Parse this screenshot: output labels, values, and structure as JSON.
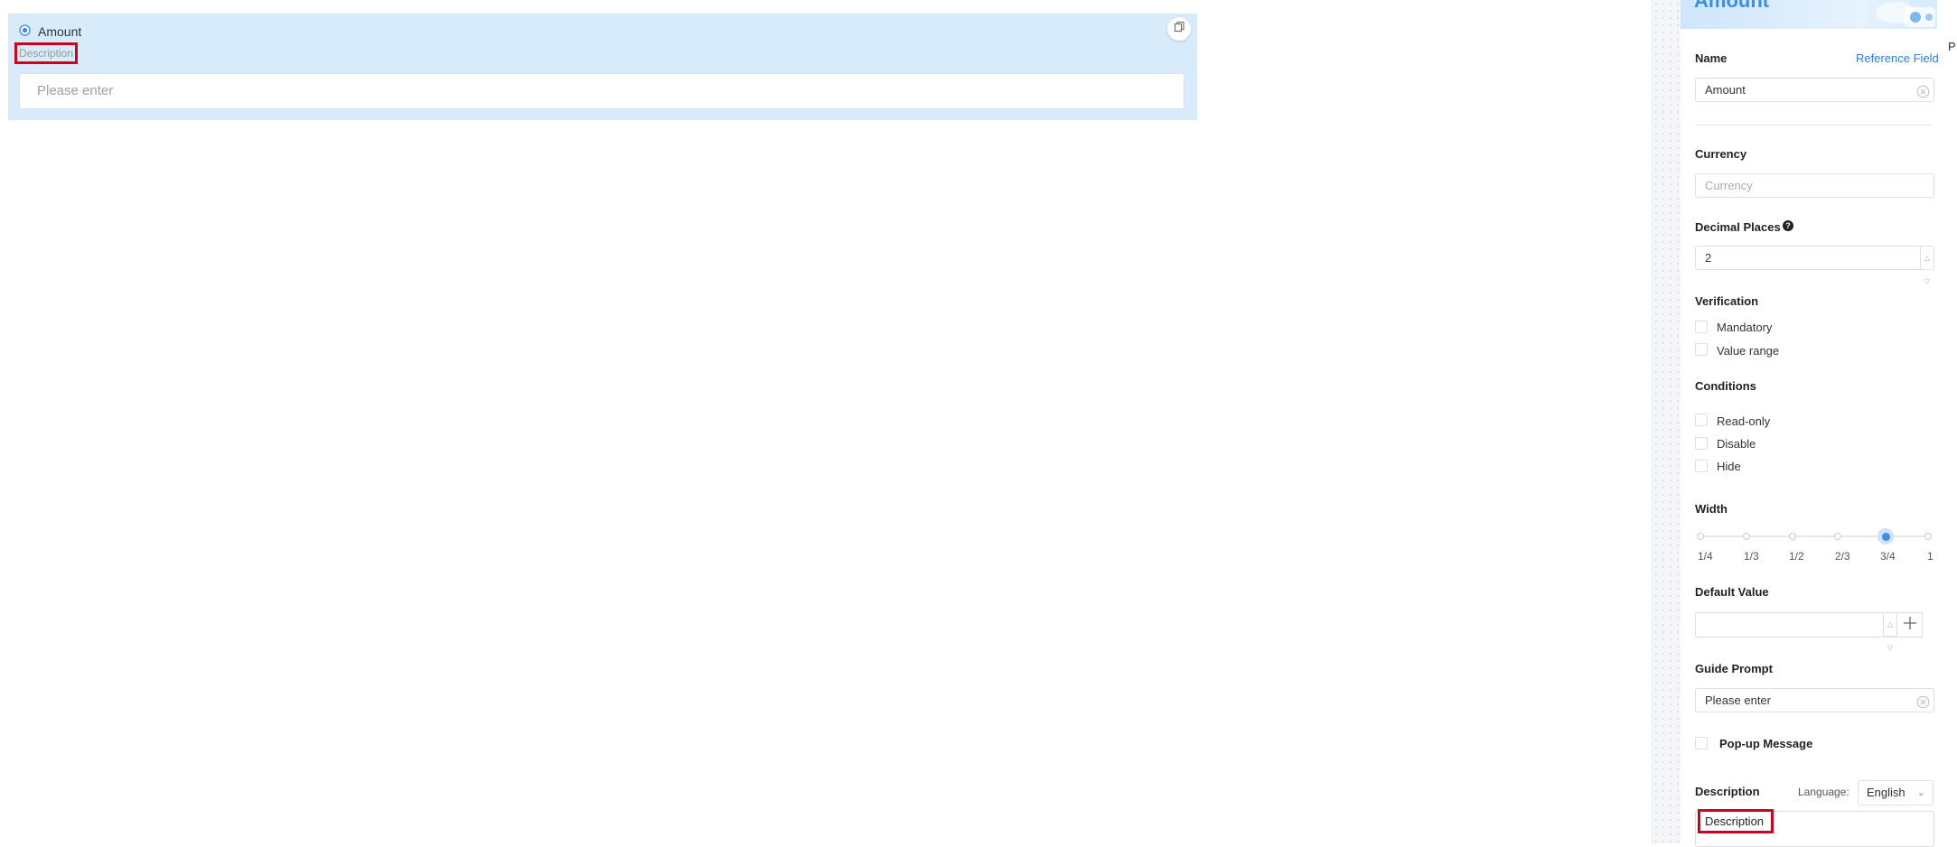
{
  "canvas": {
    "field": {
      "title": "Amount",
      "description": "Description",
      "placeholder": "Please enter"
    }
  },
  "panel": {
    "header_title": "Amount",
    "name_label": "Name",
    "reference_field_link": "Reference Field",
    "name_value": "Amount",
    "currency_label": "Currency",
    "currency_placeholder": "Currency",
    "decimal_label": "Decimal Places",
    "decimal_value": "2",
    "verification_label": "Verification",
    "verification_options": [
      "Mandatory",
      "Value range"
    ],
    "conditions_label": "Conditions",
    "conditions_options": [
      "Read-only",
      "Disable",
      "Hide"
    ],
    "width_label": "Width",
    "width_ticks": [
      "1/4",
      "1/3",
      "1/2",
      "2/3",
      "3/4",
      "1"
    ],
    "width_selected": "3/4",
    "default_value_label": "Default Value",
    "default_value": "",
    "guide_prompt_label": "Guide Prompt",
    "guide_prompt_value": "Please enter",
    "popup_message_label": "Pop-up Message",
    "description_label": "Description",
    "language_label": "Language:",
    "language_value": "English",
    "description_value": "Description",
    "right_edge_letter": "P"
  },
  "colors": {
    "accent": "#3a8ee6",
    "highlight_border": "#d0021b",
    "card_background": "#d8ebfb"
  },
  "icons": {
    "copy": "copy-icon",
    "radio": "radio-icon",
    "clear": "clear-icon",
    "help": "help-icon",
    "plus": "plus-icon",
    "chevron": "chevron-down-icon"
  }
}
